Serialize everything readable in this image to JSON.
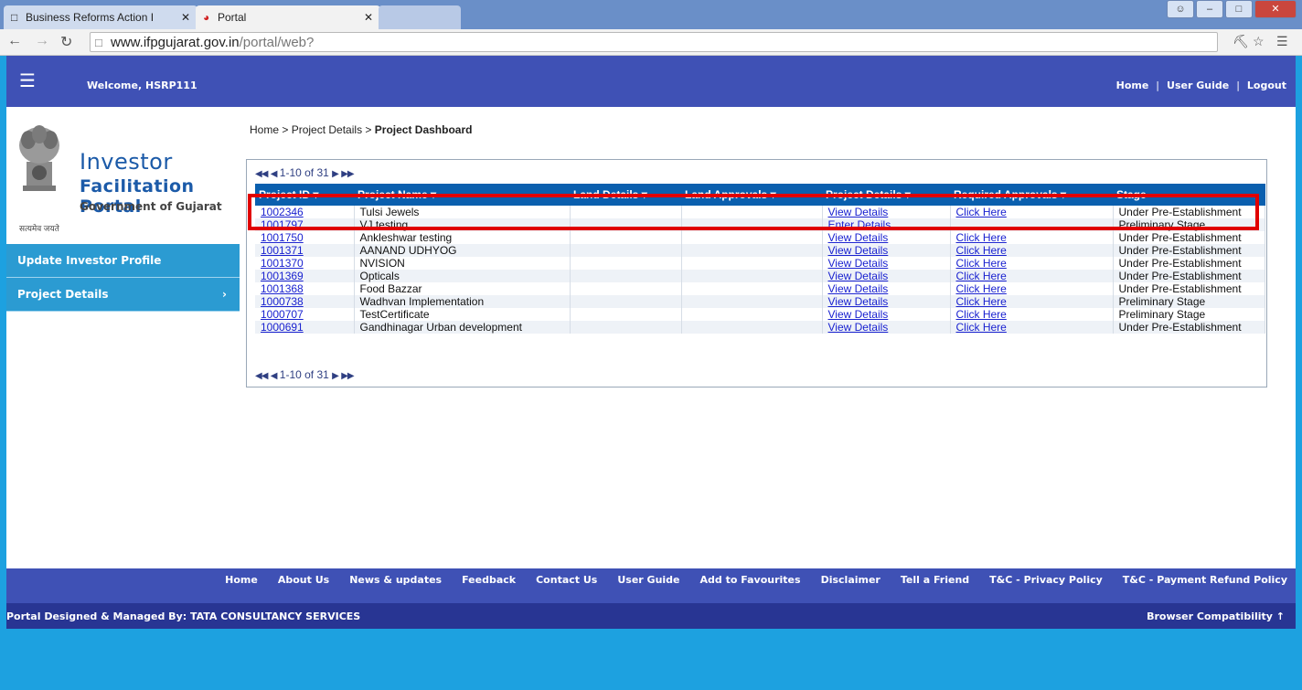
{
  "browser": {
    "tabs": [
      {
        "label": "Business Reforms Action I"
      },
      {
        "label": "Portal"
      },
      {
        "label": ""
      }
    ],
    "url_host": "www.ifpgujarat.gov.in",
    "url_path": "/portal/web?"
  },
  "header": {
    "welcome_prefix": "Welcome, ",
    "username": "HSRP111",
    "links": [
      "Home",
      "User Guide",
      "Logout"
    ]
  },
  "logo": {
    "line1": "Investor",
    "line2": "Facilitation Portal",
    "line3": "Government of Gujarat",
    "motto": "सत्यमेव जयते"
  },
  "sidebar": {
    "items": [
      {
        "label": "Update Investor Profile"
      },
      {
        "label": "Project Details"
      }
    ]
  },
  "breadcrumb": {
    "part1": "Home",
    "sep": " > ",
    "part2": "Project Details",
    "current": "Project Dashboard"
  },
  "pager": {
    "range": "1-10 of 31"
  },
  "table": {
    "headers": [
      "Project ID",
      "Project Name",
      "Land Details",
      "Land Approvals",
      "Project Details",
      "Required Approvals",
      "Stage"
    ],
    "rows": [
      {
        "id": "1002346",
        "name": "Tulsi Jewels",
        "details": "View Details",
        "approvals": "Click Here",
        "stage": "Under Pre-Establishment"
      },
      {
        "id": "1001797",
        "name": "VJ testing",
        "details": "Enter Details",
        "approvals": "",
        "stage": "Preliminary Stage"
      },
      {
        "id": "1001750",
        "name": "Ankleshwar testing",
        "details": "View Details",
        "approvals": "Click Here",
        "stage": "Under Pre-Establishment"
      },
      {
        "id": "1001371",
        "name": "AANAND UDHYOG",
        "details": "View Details",
        "approvals": "Click Here",
        "stage": "Under Pre-Establishment"
      },
      {
        "id": "1001370",
        "name": "NVISION",
        "details": "View Details",
        "approvals": "Click Here",
        "stage": "Under Pre-Establishment"
      },
      {
        "id": "1001369",
        "name": "Opticals",
        "details": "View Details",
        "approvals": "Click Here",
        "stage": "Under Pre-Establishment"
      },
      {
        "id": "1001368",
        "name": "Food Bazzar",
        "details": "View Details",
        "approvals": "Click Here",
        "stage": "Under Pre-Establishment"
      },
      {
        "id": "1000738",
        "name": "Wadhvan Implementation",
        "details": "View Details",
        "approvals": "Click Here",
        "stage": "Preliminary Stage"
      },
      {
        "id": "1000707",
        "name": "TestCertificate",
        "details": "View Details",
        "approvals": "Click Here",
        "stage": "Preliminary Stage"
      },
      {
        "id": "1000691",
        "name": "Gandhinagar Urban development",
        "details": "View Details",
        "approvals": "Click Here",
        "stage": "Under Pre-Establishment"
      }
    ]
  },
  "footer": {
    "links": [
      "Home",
      "About Us",
      "News & updates",
      "Feedback",
      "Contact Us",
      "User Guide",
      "Add to Favourites",
      "Disclaimer",
      "Tell a Friend",
      "T&C - Privacy Policy",
      "T&C - Payment Refund Policy"
    ],
    "credit": "Portal Designed & Managed By: TATA CONSULTANCY SERVICES",
    "compat": "Browser Compatibility"
  },
  "colors": {
    "header": "#3f51b5",
    "sidebar": "#2b9bd2",
    "table_header": "#0a5fae",
    "highlight": "#e00000",
    "page_bg": "#1da1e0"
  }
}
